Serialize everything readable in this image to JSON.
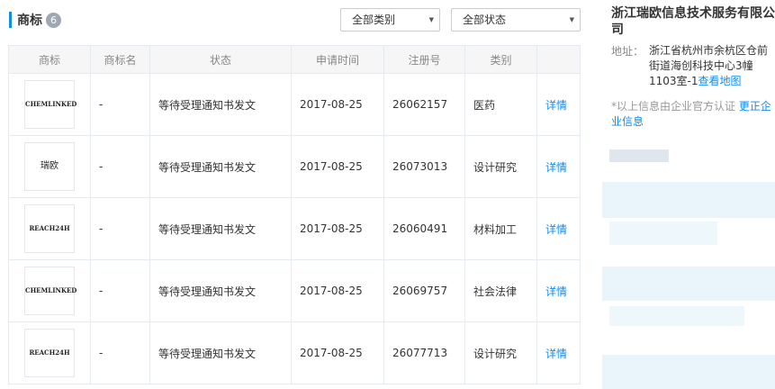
{
  "section": {
    "title": "商标",
    "count": "6"
  },
  "filters": {
    "category": {
      "selected": "全部类别"
    },
    "status": {
      "selected": "全部状态"
    }
  },
  "table": {
    "headers": [
      "商标",
      "商标名",
      "状态",
      "申请时间",
      "注册号",
      "类别",
      ""
    ],
    "rows": [
      {
        "logo": "CHEMLINKED",
        "name": "-",
        "status": "等待受理通知书发文",
        "date": "2017-08-25",
        "reg_no": "26062157",
        "category": "医药",
        "action": "详情"
      },
      {
        "logo": "瑞欧",
        "name": "-",
        "status": "等待受理通知书发文",
        "date": "2017-08-25",
        "reg_no": "26073013",
        "category": "设计研究",
        "action": "详情"
      },
      {
        "logo": "REACH24H",
        "name": "-",
        "status": "等待受理通知书发文",
        "date": "2017-08-25",
        "reg_no": "26060491",
        "category": "材料加工",
        "action": "详情"
      },
      {
        "logo": "CHEMLINKED",
        "name": "-",
        "status": "等待受理通知书发文",
        "date": "2017-08-25",
        "reg_no": "26069757",
        "category": "社会法律",
        "action": "详情"
      },
      {
        "logo": "REACH24H",
        "name": "-",
        "status": "等待受理通知书发文",
        "date": "2017-08-25",
        "reg_no": "26077713",
        "category": "设计研究",
        "action": "详情"
      }
    ]
  },
  "sidebar": {
    "company_name": "浙江瑞欧信息技术服务有限公司",
    "address_label": "地址：",
    "address": "浙江省杭州市余杭区仓前街道海创科技中心3幢1103室-1",
    "map_link": "查看地图",
    "note": "*以上信息由企业官方认证 ",
    "fix_link": "更正企业信息"
  },
  "colors": {
    "accent": "#128bed",
    "badge": "#9ea7b3",
    "header_bg": "#f6f6f6",
    "border": "#e4eaf0"
  }
}
